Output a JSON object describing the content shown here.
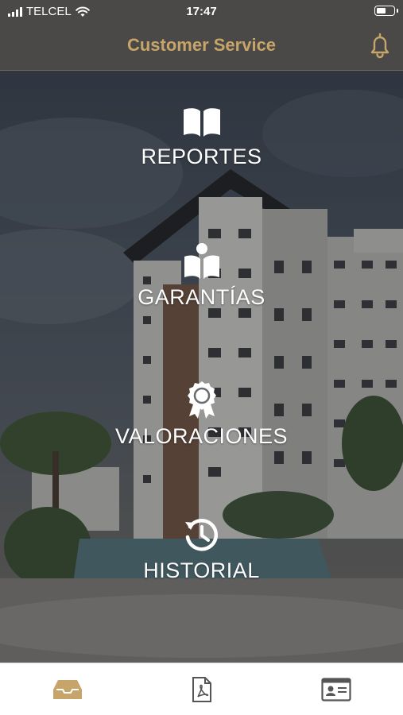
{
  "status_bar": {
    "carrier": "TELCEL",
    "time": "17:47",
    "battery_level": 0.6
  },
  "header": {
    "title": "Customer Service",
    "icon": "bell-icon",
    "accent_color": "#c7a56a"
  },
  "menu": [
    {
      "id": "reportes",
      "label": "REPORTES",
      "icon": "book-icon"
    },
    {
      "id": "garantias",
      "label": "GARANTÍAS",
      "icon": "reader-icon"
    },
    {
      "id": "valoraciones",
      "label": "VALORACIONES",
      "icon": "award-icon"
    },
    {
      "id": "historial",
      "label": "HISTORIAL",
      "icon": "history-icon"
    }
  ],
  "tabs": [
    {
      "id": "inbox",
      "icon": "inbox-tray-icon",
      "active": true,
      "color": "#c7a56a"
    },
    {
      "id": "pdf",
      "icon": "pdf-file-icon",
      "active": false,
      "color": "#555555"
    },
    {
      "id": "id-card",
      "icon": "id-card-icon",
      "active": false,
      "color": "#555555"
    }
  ]
}
